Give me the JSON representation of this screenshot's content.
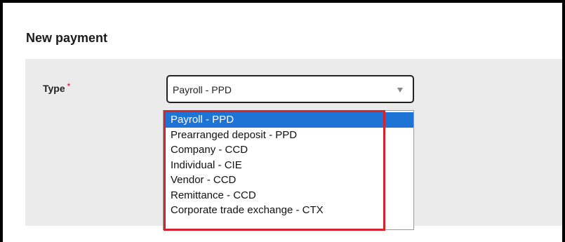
{
  "page": {
    "title": "New payment"
  },
  "form": {
    "type_label": "Type",
    "required_marker": "*",
    "type_select": {
      "value": "Payroll - PPD"
    }
  },
  "dropdown": {
    "options": [
      {
        "label": "Payroll - PPD",
        "selected": true
      },
      {
        "label": "Prearranged deposit - PPD",
        "selected": false
      },
      {
        "label": "Company - CCD",
        "selected": false
      },
      {
        "label": "Individual - CIE",
        "selected": false
      },
      {
        "label": "Vendor - CCD",
        "selected": false
      },
      {
        "label": "Remittance - CCD",
        "selected": false
      },
      {
        "label": "Corporate trade exchange - CTX",
        "selected": false
      }
    ]
  },
  "colors": {
    "selected_option_bg": "#1e73d6",
    "highlight_box": "#d6222c",
    "required_marker": "#d0021b",
    "panel_bg": "#ebebeb"
  },
  "icons": {
    "select_arrow": "chevron-down-icon"
  }
}
